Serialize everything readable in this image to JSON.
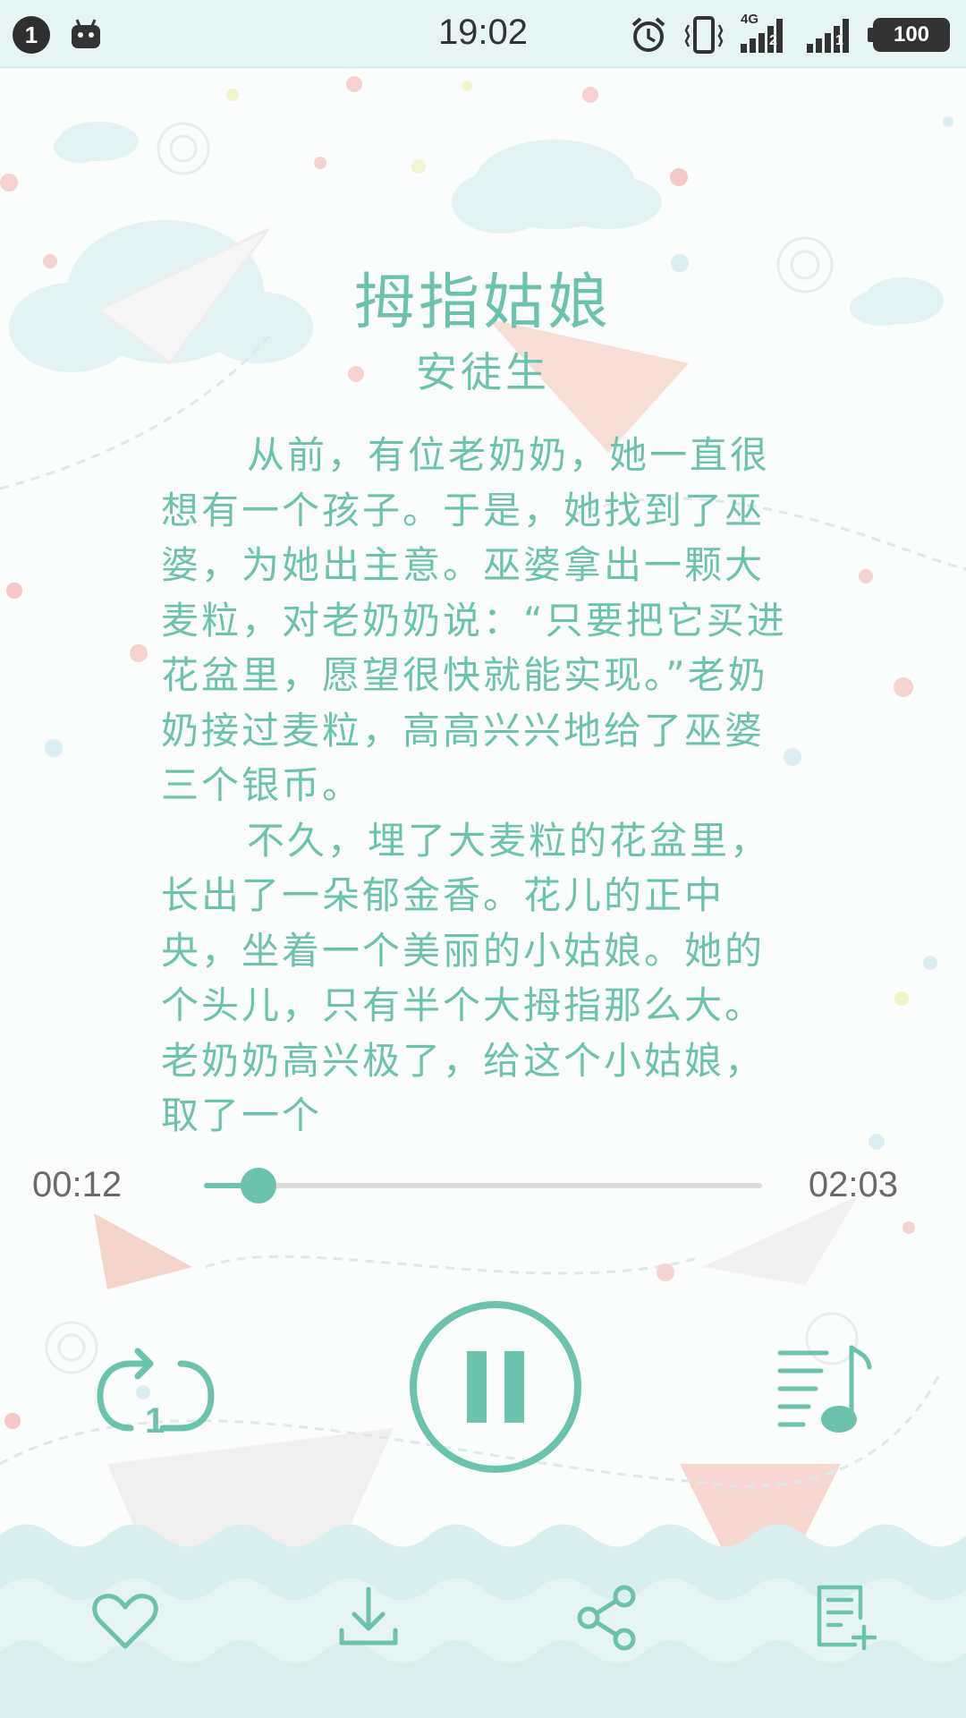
{
  "status_bar": {
    "notification_count": "1",
    "time": "19:02",
    "network": "4G",
    "sim1": "2",
    "sim2": "1",
    "battery": "100",
    "icons": [
      "android-icon",
      "alarm-icon",
      "vibrate-icon",
      "signal-icon",
      "battery-icon"
    ]
  },
  "story": {
    "title": "拇指姑娘",
    "author": "安徒生",
    "paragraphs": [
      "从前，有位老奶奶，她一直很想有一个孩子。于是，她找到了巫婆，为她出主意。巫婆拿出一颗大麦粒，对老奶奶说：“只要把它买进花盆里，愿望很快就能实现。”老奶奶接过麦粒，高高兴兴地给了巫婆三个银币。",
      "不久，埋了大麦粒的花盆里，长出了一朵郁金香。花儿的正中央，坐着一个美丽的小姑娘。她的个头儿，只有半个大拇指那么大。老奶奶高兴极了，给这个小姑娘，取了一个"
    ]
  },
  "player": {
    "elapsed": "00:12",
    "duration": "02:03",
    "progress": 0.098,
    "loop_mode_label": "1"
  },
  "colors": {
    "accent": "#6cc3ad",
    "status_bar_bg": "#e6f4f4",
    "track": "#dcdcdc"
  },
  "bottom_bar": {
    "icons": [
      "heart-icon",
      "download-icon",
      "share-icon",
      "add-to-playlist-icon"
    ]
  }
}
